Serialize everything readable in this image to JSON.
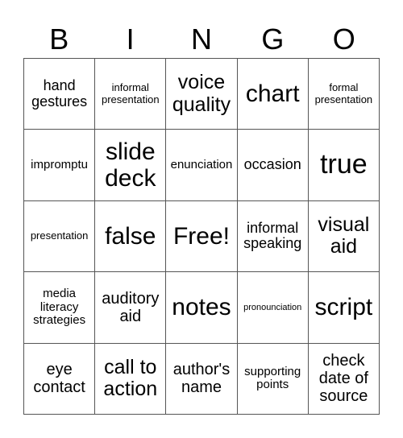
{
  "header": [
    "B",
    "I",
    "N",
    "G",
    "O"
  ],
  "cells": [
    {
      "text": "hand gestures",
      "size": "s-ml"
    },
    {
      "text": "informal presentation",
      "size": "s-s"
    },
    {
      "text": "voice quality",
      "size": "s-xl"
    },
    {
      "text": "chart",
      "size": "s-xxl"
    },
    {
      "text": "formal presentation",
      "size": "s-s"
    },
    {
      "text": "impromptu",
      "size": "s-m"
    },
    {
      "text": "slide deck",
      "size": "s-xxl"
    },
    {
      "text": "enunciation",
      "size": "s-m"
    },
    {
      "text": "occasion",
      "size": "s-ml"
    },
    {
      "text": "true",
      "size": "s-xxxl"
    },
    {
      "text": "presentation",
      "size": "s-s"
    },
    {
      "text": "false",
      "size": "s-xxl"
    },
    {
      "text": "Free!",
      "size": "s-xxl"
    },
    {
      "text": "informal speaking",
      "size": "s-ml"
    },
    {
      "text": "visual aid",
      "size": "s-xl"
    },
    {
      "text": "media literacy strategies",
      "size": "s-m"
    },
    {
      "text": "auditory aid",
      "size": "s-l"
    },
    {
      "text": "notes",
      "size": "s-xxl"
    },
    {
      "text": "pronounciation",
      "size": "s-xs"
    },
    {
      "text": "script",
      "size": "s-xxl"
    },
    {
      "text": "eye contact",
      "size": "s-l"
    },
    {
      "text": "call to action",
      "size": "s-xl"
    },
    {
      "text": "author's name",
      "size": "s-l"
    },
    {
      "text": "supporting points",
      "size": "s-m"
    },
    {
      "text": "check date of source",
      "size": "s-l"
    }
  ]
}
